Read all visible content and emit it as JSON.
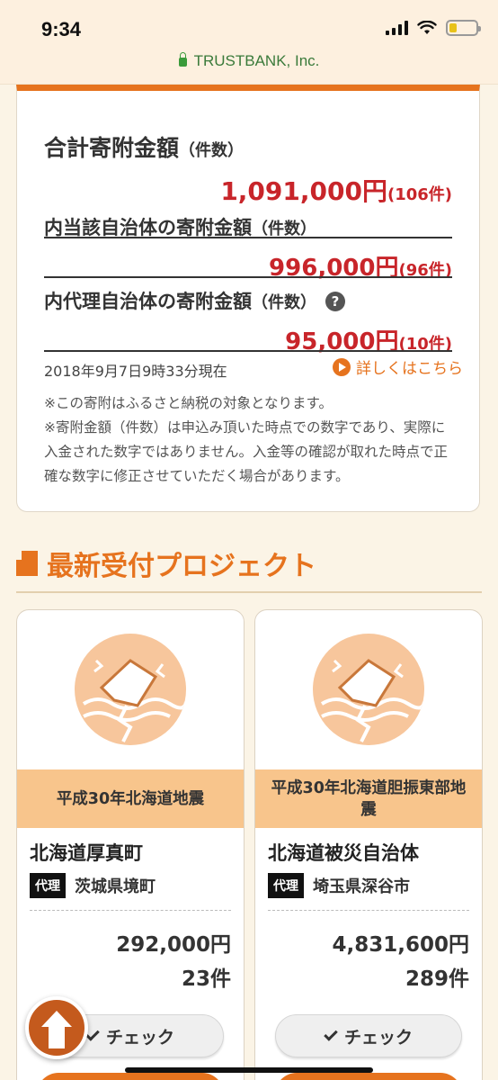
{
  "status_bar": {
    "time": "9:34"
  },
  "browser": {
    "url_label": "TRUSTBANK, Inc."
  },
  "summary": {
    "total": {
      "label": "合計寄附金額",
      "label_suffix": "（件数）",
      "amount": "1,091,000円",
      "count": "(106件)"
    },
    "local": {
      "label": "内当該自治体の寄附金額",
      "label_suffix": "（件数）",
      "amount": "996,000円",
      "count": "(96件)"
    },
    "proxy": {
      "label": "内代理自治体の寄附金額",
      "label_suffix": "（件数）",
      "amount": "95,000円",
      "count": "(10件)",
      "help_icon": "?"
    },
    "as_of": "2018年9月7日9時33分現在",
    "details_link": "詳しくはこちら",
    "note1": "※この寄附はふるさと納税の対象となります。",
    "note2": "※寄附金額（件数）は申込み頂いた時点での数字であり、実際に入金された数字ではありません。入金等の確認が取れた時点で正確な数字に修正させていただく場合があります。"
  },
  "section": {
    "title": "最新受付プロジェクト"
  },
  "projects": [
    {
      "tag": "平成30年北海道地震",
      "municipality": "北海道厚真町",
      "proxy_badge": "代理",
      "proxy_municipality": "茨城県境町",
      "amount": "292,000円",
      "count": "23件",
      "check_label": "チェック",
      "illustration": "earthquake-icon"
    },
    {
      "tag": "平成30年北海道胆振東部地震",
      "municipality": "北海道被災自治体",
      "proxy_badge": "代理",
      "proxy_municipality": "埼玉県深谷市",
      "amount": "4,831,600円",
      "count": "289件",
      "check_label": "チェック",
      "illustration": "earthquake-icon"
    }
  ],
  "colors": {
    "accent": "#e6731e",
    "amount_red": "#c8252a",
    "tag_bg": "#f8c58c",
    "page_bg": "#fbf4e6"
  }
}
